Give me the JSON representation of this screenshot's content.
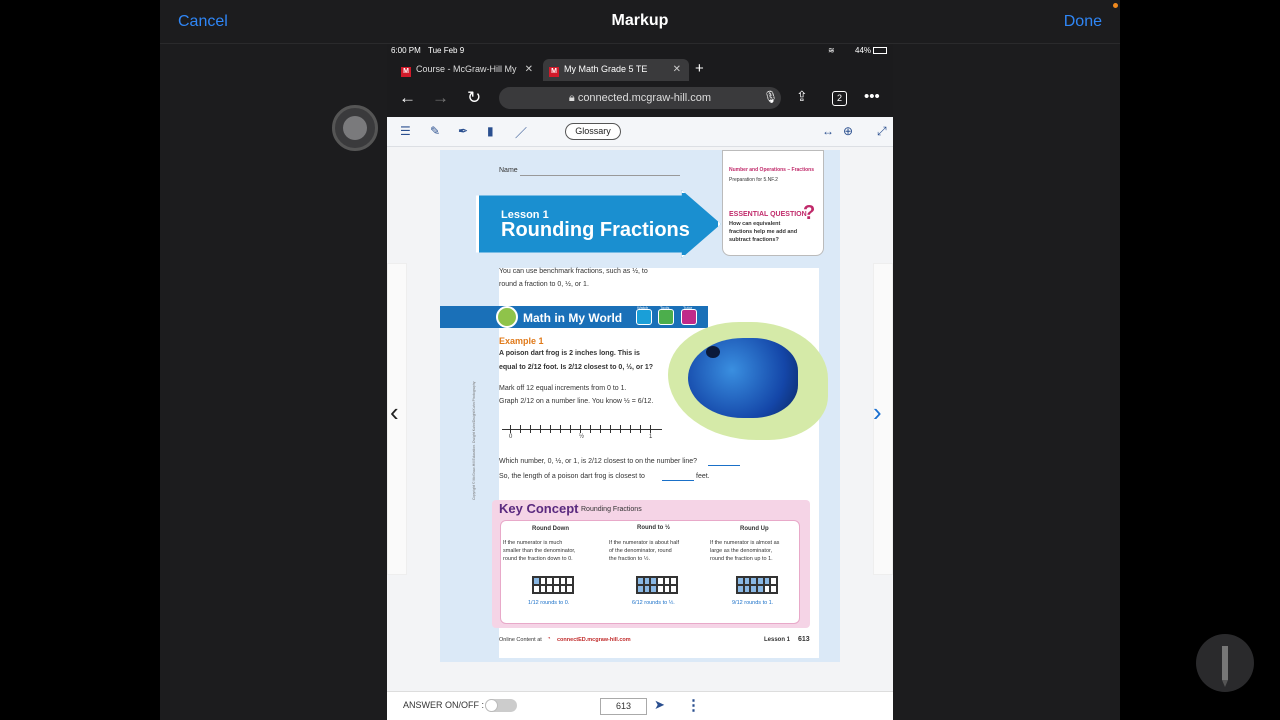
{
  "markup": {
    "cancel": "Cancel",
    "title": "Markup",
    "done": "Done"
  },
  "status": {
    "time": "6:00 PM",
    "date": "Tue Feb 9",
    "battery": "44%"
  },
  "tabs": [
    {
      "label": "Course - McGraw-Hill My",
      "favicon": "M"
    },
    {
      "label": "My Math Grade 5 TE",
      "favicon": "M"
    }
  ],
  "url": "connected.mcgraw-hill.com",
  "tab_count": "2",
  "viewer": {
    "glossary": "Glossary"
  },
  "page": {
    "name_label": "Name",
    "standard_domain": "Number and Operations – Fractions",
    "standard_prep": "Preparation for 5.NF.2",
    "eq_title": "ESSENTIAL QUESTION",
    "eq_text1": "How can equivalent",
    "eq_text2": "fractions help me add and",
    "eq_text3": "subtract fractions?",
    "lesson_num": "Lesson 1",
    "lesson_title": "Rounding Fractions",
    "intro1": "You can use benchmark fractions, such as ½, to",
    "intro2": "round a fraction to 0, ½, or 1.",
    "world_title": "Math in My World",
    "icon_labels": [
      "Watch",
      "Tools",
      "Tutor"
    ],
    "ex_title": "Example 1",
    "ex_line1": "A poison dart frog is 2 inches long. This is",
    "ex_line2": "equal to 2/12 foot. Is 2/12 closest to 0, ½, or 1?",
    "mark1": "Mark off 12 equal increments from 0 to 1.",
    "mark2": "Graph 2/12 on a number line. You know ½ = 6/12.",
    "nl_0": "0",
    "nl_half": "½",
    "nl_1": "1",
    "which": "Which number, 0, ½, or 1, is 2/12 closest to on the number line?",
    "so_line": "So, the length of a poison dart frog is closest to",
    "feet": "feet.",
    "kc_title": "Key Concept",
    "kc_sub": "Rounding Fractions",
    "kc_cols": [
      {
        "head": "Round Down",
        "l1": "If the numerator is much",
        "l2": "smaller than the denominator,",
        "l3": "round the fraction down to 0.",
        "ex": "1/12 rounds to 0."
      },
      {
        "head": "Round to ½",
        "l1": "If the numerator is about half",
        "l2": "of the denominator, round",
        "l3": "the fraction to ½.",
        "ex": "6/12 rounds to ½."
      },
      {
        "head": "Round Up",
        "l1": "If the numerator is almost as",
        "l2": "large as the denominator,",
        "l3": "round the fraction up to 1.",
        "ex": "9/12 rounds to 1."
      }
    ],
    "footer_online": "Online Content at",
    "footer_url": "connectED.mcgraw-hill.com",
    "footer_lesson": "Lesson 1",
    "footer_page": "613",
    "copyright": "Copyright © McGraw-Hill Education. Dwight Kuhn/Dwight Kuhn Photography"
  },
  "bottom": {
    "answer_label": "ANSWER ON/OFF :",
    "page_value": "613"
  }
}
